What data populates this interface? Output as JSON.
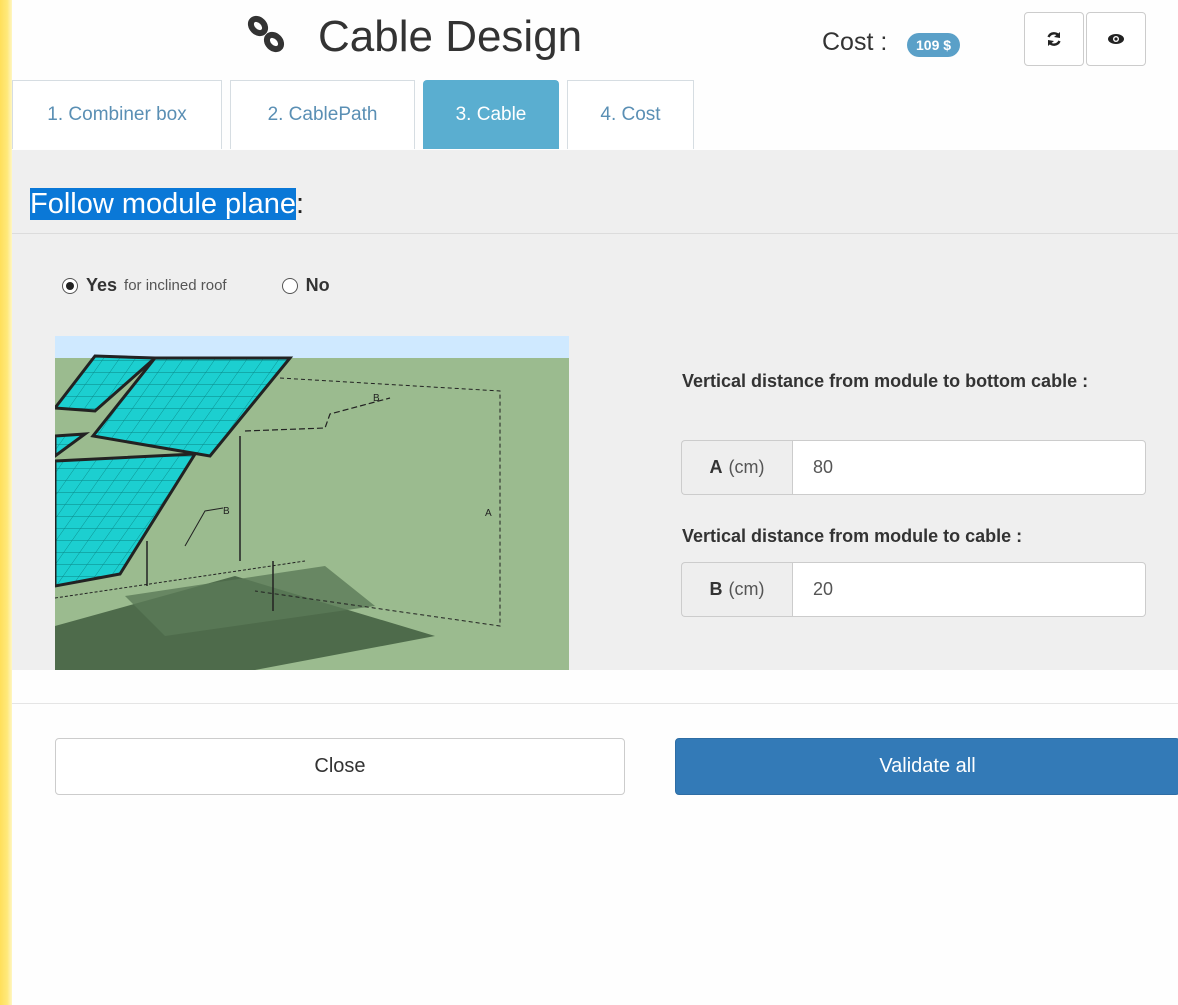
{
  "header": {
    "title": "Cable Design",
    "cost_label": "Cost :",
    "cost_value": "109 $"
  },
  "tabs": [
    {
      "label": "1. Combiner box"
    },
    {
      "label": "2. CablePath"
    },
    {
      "label": "3. Cable",
      "active": true
    },
    {
      "label": "4. Cost"
    }
  ],
  "section": {
    "title_highlight": "Follow module plane",
    "title_suffix": ":"
  },
  "radio": {
    "yes_label": "Yes",
    "yes_hint": "for inclined roof",
    "no_label": "No",
    "selected": "yes"
  },
  "illustration": {
    "labels": [
      "B",
      "B",
      "A"
    ]
  },
  "fields": {
    "a_label": "Vertical distance from module to bottom cable :",
    "a_addon_letter": "A",
    "a_addon_unit": "(cm)",
    "a_value": "80",
    "b_label": "Vertical distance from module to cable :",
    "b_addon_letter": "B",
    "b_addon_unit": "(cm)",
    "b_value": "20"
  },
  "buttons": {
    "close": "Close",
    "validate": "Validate all"
  },
  "colors": {
    "accent": "#337ab7",
    "active_tab": "#5aaed0",
    "badge": "#5aa0c8",
    "highlight": "#0a78d7"
  }
}
